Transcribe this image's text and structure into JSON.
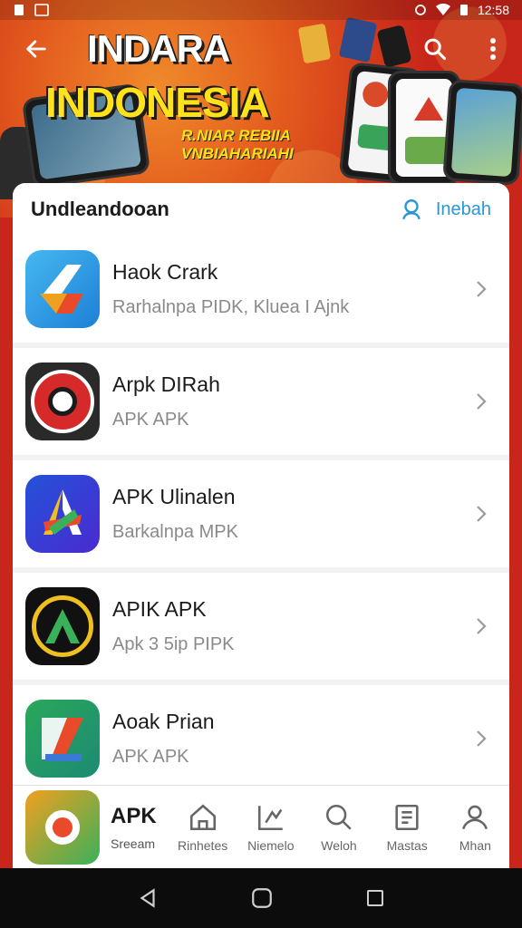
{
  "status_bar": {
    "time": "12:58"
  },
  "banner": {
    "title_line1": "INDARA",
    "title_line2": "INDONESIA",
    "subtitle_line1": "R.NIAR REBIIA",
    "subtitle_line2": "VNBIAHARIAHI"
  },
  "header": {
    "title": "Undleandooan",
    "action_label": "Inebah"
  },
  "apps": [
    {
      "title": "Haok Crark",
      "subtitle": "Rarhalnpa PIDK, Kluea I Ajnk"
    },
    {
      "title": "Arpk DIRah",
      "subtitle": "APK APK"
    },
    {
      "title": "APK Ulinalen",
      "subtitle": "Barkalnpa MPK"
    },
    {
      "title": "APIK APK",
      "subtitle": "Apk 3 5ip PIPK"
    },
    {
      "title": "Aoak Prian",
      "subtitle": "APK APK"
    }
  ],
  "bottom_nav": {
    "brand_title": "APK",
    "brand_sub": "Sreeam",
    "items": [
      {
        "label": "Rinhetes",
        "icon": "home-icon"
      },
      {
        "label": "Niemelo",
        "icon": "chart-icon"
      },
      {
        "label": "Weloh",
        "icon": "search-icon"
      },
      {
        "label": "Mastas",
        "icon": "document-icon"
      },
      {
        "label": "Mhan",
        "icon": "person-icon"
      }
    ]
  },
  "colors": {
    "accent": "#2a96d6",
    "banner_red": "#c8261a",
    "banner_yellow": "#ffe21a"
  }
}
